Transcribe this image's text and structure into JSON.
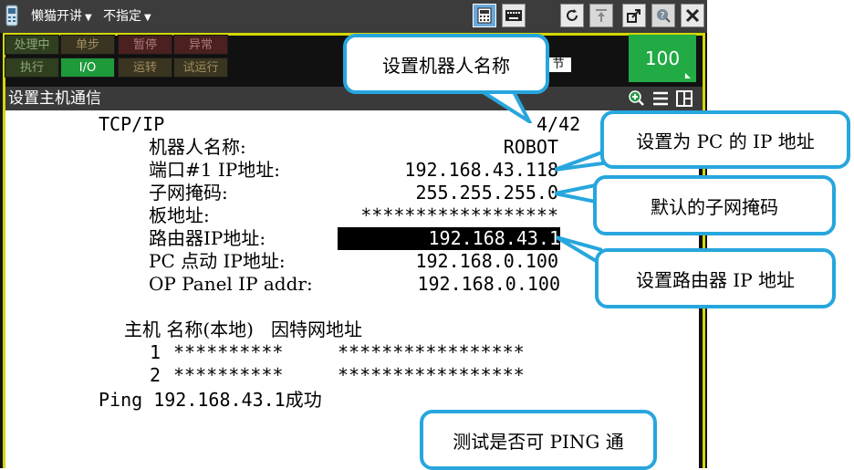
{
  "topbar": {
    "program_label": "懒猫开讲",
    "mode_label": "不指定",
    "icons": [
      "teach-pendant-icon",
      "screen-icon",
      "keyboard-icon",
      "refresh-icon",
      "transfer-icon",
      "export-icon",
      "help-icon",
      "close-icon"
    ]
  },
  "status_panel": {
    "row1": [
      "处理中",
      "单步",
      "暂停",
      "异常"
    ],
    "row2": [
      "执行",
      "I/O",
      "运转",
      "试运行"
    ],
    "strip_text": "节",
    "override": "100"
  },
  "screen_title": "设置主机通信",
  "content": {
    "header_left": "TCP/IP",
    "header_right": "4/42",
    "rows": [
      {
        "label": "机器人名称:",
        "value": "ROBOT"
      },
      {
        "label": "端口#1 IP地址:",
        "value": "192.168.43.118"
      },
      {
        "label": "子网掩码:",
        "value": "255.255.255.0"
      },
      {
        "label": "板地址:",
        "value": "******************"
      },
      {
        "label": "路由器IP地址:",
        "value": "192.168.43.1"
      },
      {
        "label": "PC 点动 IP地址:",
        "value": "192.168.0.100"
      },
      {
        "label": "OP Panel IP addr:",
        "value": "192.168.0.100"
      }
    ],
    "host_header": "主机 名称(本地)   因特网地址",
    "host_rows": [
      {
        "index": "1",
        "name": "**********",
        "address": "*****************"
      },
      {
        "index": "2",
        "name": "**********",
        "address": "*****************"
      }
    ],
    "ping_message": "Ping 192.168.43.1成功"
  },
  "callouts": {
    "robot_name": "设置机器人名称",
    "ip_address": "设置为 PC 的 IP 地址",
    "subnet": "默认的子网掩码",
    "router": "设置路由器 IP 地址",
    "ping": "测试是否可 PING 通"
  },
  "colors": {
    "callout_border": "#27a6dd",
    "panel_border": "#d4d800",
    "override_bg": "#22aa44",
    "active_green": "#1e9a3a"
  }
}
